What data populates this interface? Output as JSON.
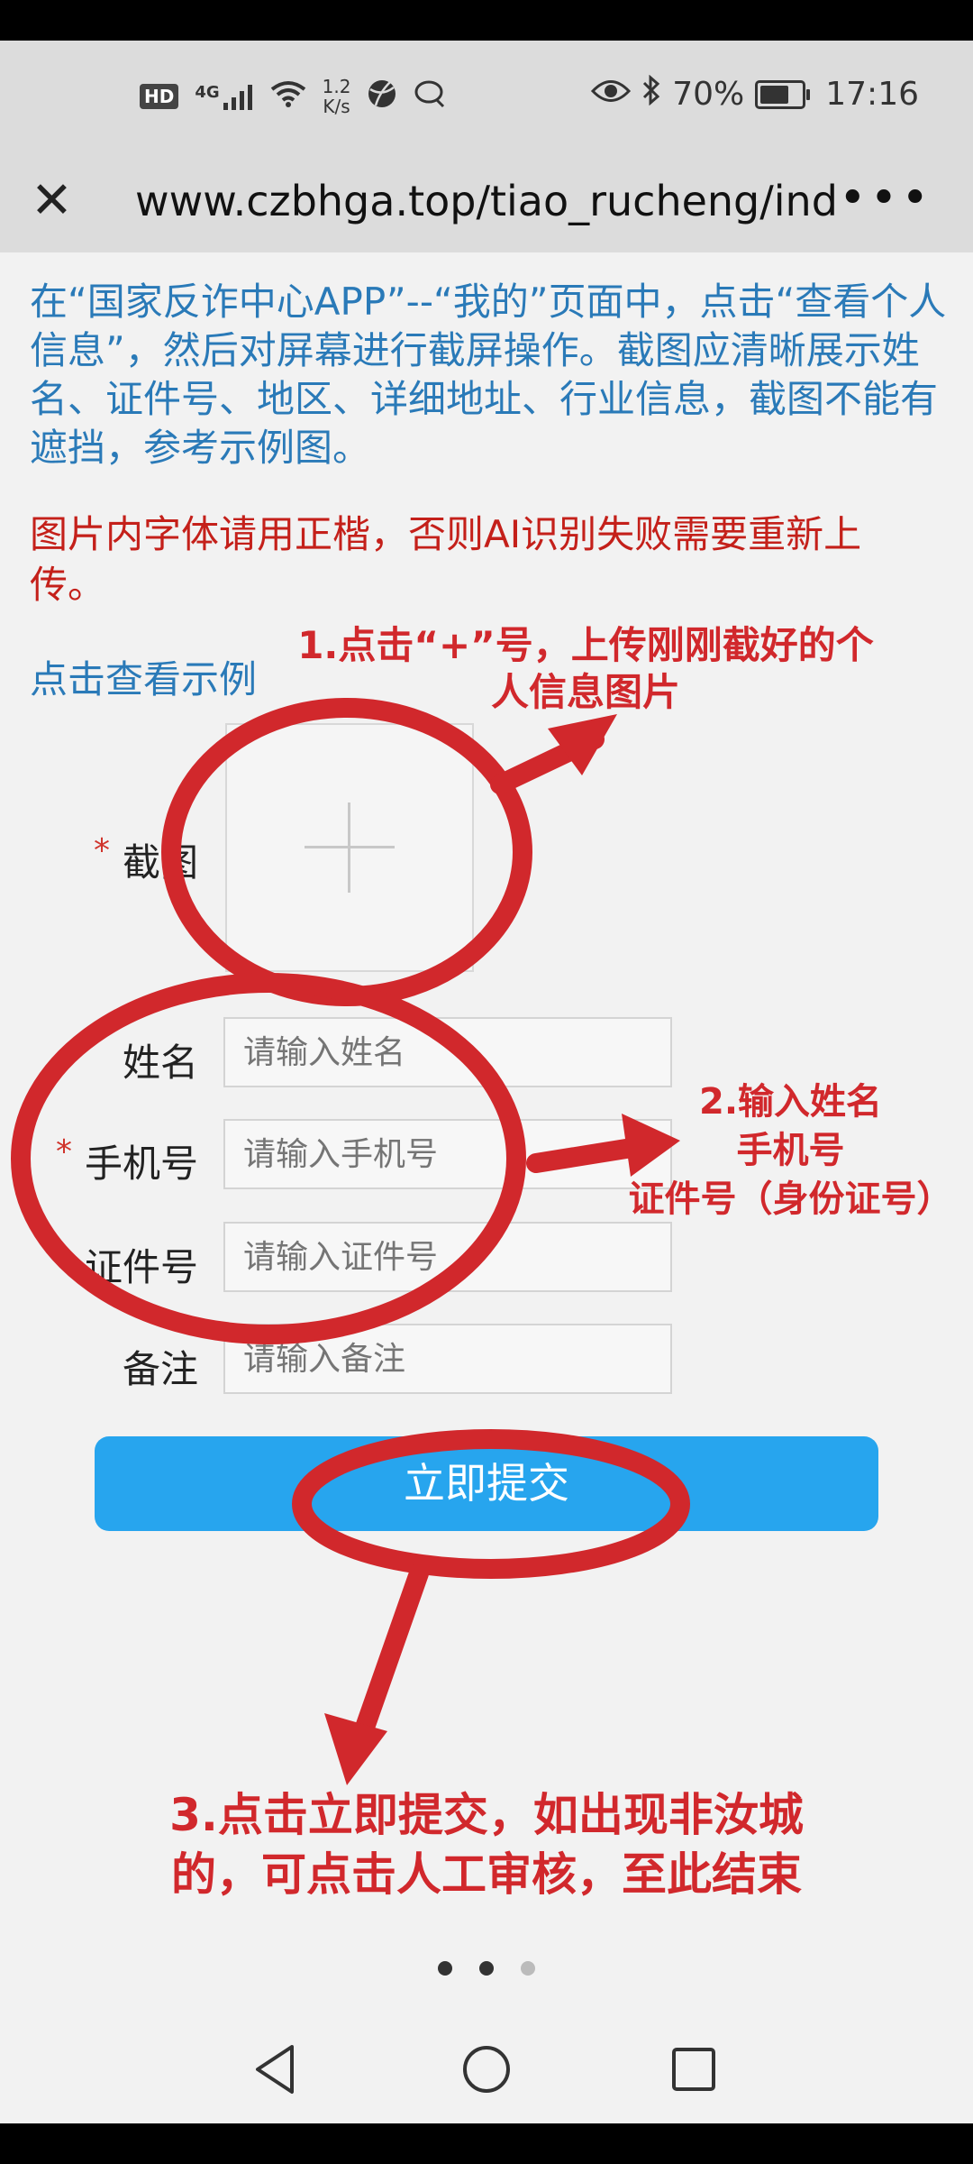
{
  "status_bar": {
    "hd": "HD",
    "network": "4G",
    "speed_value": "1.2",
    "speed_unit": "K/s",
    "battery_percent": "70%",
    "battery_level": 0.7,
    "time": "17:16"
  },
  "browser": {
    "url": "www.czbhga.top/tiao_rucheng/ind...",
    "menu_label": "•••"
  },
  "page": {
    "instruction": "在“国家反诈中心APP”--“我的”页面中，点击“查看个人信息”，然后对屏幕进行截屏操作。截图应清晰展示姓名、证件号、地区、详细地址、行业信息，截图不能有遮挡，参考示例图。",
    "warning": "图片内字体请用正楷，否则AI识别失败需要重新上传。",
    "example_link": "点击查看示例",
    "form": {
      "screenshot_label": "截图",
      "name_label": "姓名",
      "name_placeholder": "请输入姓名",
      "phone_label": "手机号",
      "phone_placeholder": "请输入手机号",
      "id_label": "证件号",
      "id_placeholder": "请输入证件号",
      "note_label": "备注",
      "note_placeholder": "请输入备注",
      "required_mark": "*",
      "submit_label": "立即提交"
    }
  },
  "annotations": {
    "step1_line1": "1.点击“+”号，上传刚刚截好的个",
    "step1_line2": "人信息图片",
    "step2_line1": "2.输入姓名",
    "step2_line2": "手机号",
    "step2_line3": "证件号（身份证号）",
    "step3_line1": "3.点击立即提交，如出现非汝城",
    "step3_line2": "的，可点击人工审核，至此结束",
    "color": "#d1282c"
  },
  "pager": {
    "count": 3,
    "active": 1
  },
  "colors": {
    "link_blue": "#2a7ab8",
    "warn_red": "#c4201a",
    "submit_blue": "#27a5ee"
  }
}
